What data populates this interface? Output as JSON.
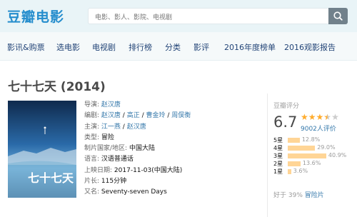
{
  "header": {
    "logo": "豆瓣电影",
    "search_placeholder": "电影、影人、影院、电视剧"
  },
  "nav": [
    "影讯&购票",
    "选电影",
    "电视剧",
    "排行榜",
    "分类",
    "影评",
    "2016年度榜单",
    "2016观影报告"
  ],
  "movie": {
    "title": "七十七天 (2014)",
    "poster_title": "七十七天",
    "info": {
      "director_label": "导演:",
      "director": "赵汉唐",
      "writer_label": "编剧:",
      "writers": [
        "赵汉唐",
        "高正",
        "曹金玲",
        "周俣衡"
      ],
      "cast_label": "主演:",
      "cast": [
        "江一燕",
        "赵汉唐"
      ],
      "genre_label": "类型:",
      "genre": "冒险",
      "country_label": "制片国家/地区:",
      "country": "中国大陆",
      "language_label": "语言:",
      "language": "汉语普通话",
      "release_label": "上映日期:",
      "release": "2017-11-03(中国大陆)",
      "runtime_label": "片长:",
      "runtime": "115分钟",
      "aka_label": "又名:",
      "aka": "Seventy-seven Days",
      "sep": " / "
    }
  },
  "rating": {
    "heading": "豆瓣评分",
    "score": "6.7",
    "stars": 3.5,
    "votes": "9002人评价",
    "distribution": [
      {
        "label": "5星",
        "percent": 12.8,
        "text": "12.8%"
      },
      {
        "label": "4星",
        "percent": 29.0,
        "text": "29.0%"
      },
      {
        "label": "3星",
        "percent": 40.9,
        "text": "40.9%"
      },
      {
        "label": "2星",
        "percent": 13.6,
        "text": "13.6%"
      },
      {
        "label": "1星",
        "percent": 3.6,
        "text": "3.6%"
      }
    ],
    "better_than": "好于 39%",
    "better_link": "冒险片"
  },
  "colors": {
    "brand": "#258dcd",
    "link": "#3377aa",
    "star": "#ffac2d",
    "bar": "#ffd596"
  }
}
